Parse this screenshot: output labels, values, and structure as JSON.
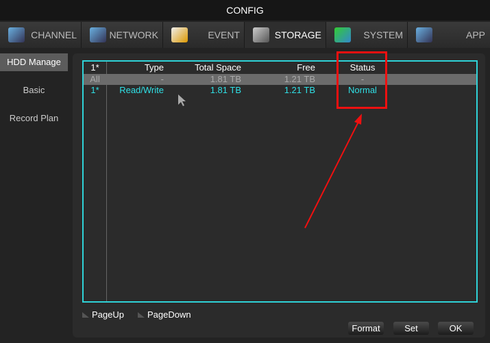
{
  "title": "CONFIG",
  "tabs": [
    {
      "label": "CHANNEL",
      "icon": "camera-gear-icon"
    },
    {
      "label": "NETWORK",
      "icon": "network-gear-icon"
    },
    {
      "label": "EVENT",
      "icon": "event-alert-icon"
    },
    {
      "label": "STORAGE",
      "icon": "storage-gear-icon",
      "active": true
    },
    {
      "label": "SYSTEM",
      "icon": "system-gear-icon"
    },
    {
      "label": "APP",
      "icon": "app-icon"
    }
  ],
  "sidebar": [
    {
      "label": "HDD Manage",
      "active": true
    },
    {
      "label": "Basic"
    },
    {
      "label": "Record Plan"
    }
  ],
  "table": {
    "headers": [
      "1*",
      "Type",
      "Total Space",
      "Free",
      "Status"
    ],
    "rows": [
      [
        "All",
        "-",
        "1.81 TB",
        "1.21 TB",
        "-"
      ],
      [
        "1*",
        "Read/Write",
        "1.81 TB",
        "1.21 TB",
        "Normal"
      ]
    ]
  },
  "paging": {
    "up": "PageUp",
    "down": "PageDown"
  },
  "buttons": {
    "format": "Format",
    "set": "Set",
    "ok": "OK"
  },
  "colors": {
    "accent": "#2fd3d8",
    "annotation": "#f01010"
  }
}
